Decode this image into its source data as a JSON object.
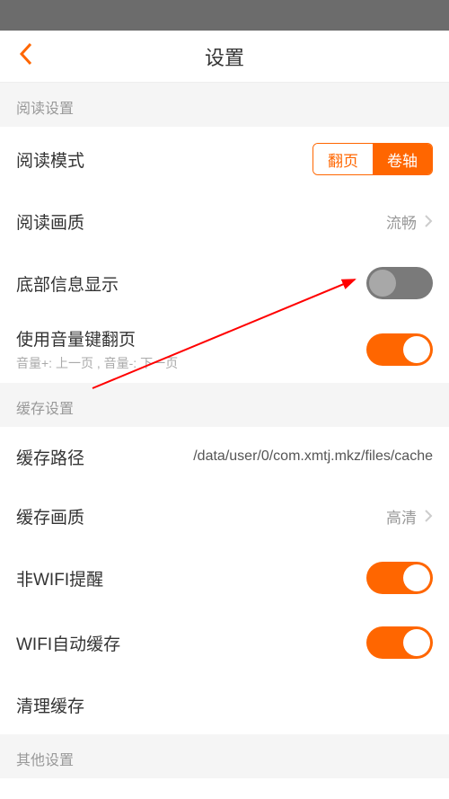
{
  "header": {
    "title": "设置"
  },
  "sections": {
    "reading": {
      "header": "阅读设置",
      "mode_label": "阅读模式",
      "mode_option_page": "翻页",
      "mode_option_scroll": "卷轴",
      "quality_label": "阅读画质",
      "quality_value": "流畅",
      "bottom_info_label": "底部信息显示",
      "volume_page_label": "使用音量键翻页",
      "volume_page_sublabel": "音量+: 上一页 , 音量-: 下一页"
    },
    "cache": {
      "header": "缓存设置",
      "path_label": "缓存路径",
      "path_value": "/data/user/0/com.xmtj.mkz/files/cache",
      "quality_label": "缓存画质",
      "quality_value": "高清",
      "nonwifi_label": "非WIFI提醒",
      "wifi_auto_label": "WIFI自动缓存",
      "clear_label": "清理缓存"
    },
    "other": {
      "header": "其他设置"
    }
  }
}
